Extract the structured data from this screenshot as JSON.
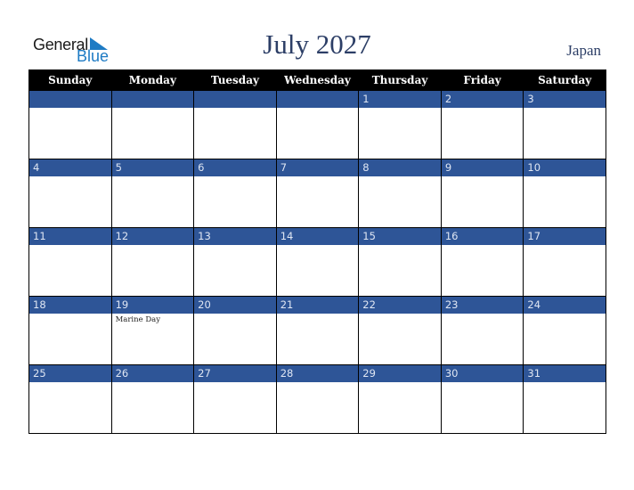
{
  "logo": {
    "word1": "General",
    "word2": "Blue",
    "icon": "triangle-flag-icon"
  },
  "header": {
    "title": "July 2027",
    "country": "Japan"
  },
  "colors": {
    "accent": "#2e5597",
    "header_bg": "#000000",
    "title": "#2c3e66",
    "logo_blue": "#1e7bc4"
  },
  "weekdays": [
    "Sunday",
    "Monday",
    "Tuesday",
    "Wednesday",
    "Thursday",
    "Friday",
    "Saturday"
  ],
  "weeks": [
    [
      {
        "day": ""
      },
      {
        "day": ""
      },
      {
        "day": ""
      },
      {
        "day": ""
      },
      {
        "day": "1"
      },
      {
        "day": "2"
      },
      {
        "day": "3"
      }
    ],
    [
      {
        "day": "4"
      },
      {
        "day": "5"
      },
      {
        "day": "6"
      },
      {
        "day": "7"
      },
      {
        "day": "8"
      },
      {
        "day": "9"
      },
      {
        "day": "10"
      }
    ],
    [
      {
        "day": "11"
      },
      {
        "day": "12"
      },
      {
        "day": "13"
      },
      {
        "day": "14"
      },
      {
        "day": "15"
      },
      {
        "day": "16"
      },
      {
        "day": "17"
      }
    ],
    [
      {
        "day": "18"
      },
      {
        "day": "19",
        "holiday": "Marine Day"
      },
      {
        "day": "20"
      },
      {
        "day": "21"
      },
      {
        "day": "22"
      },
      {
        "day": "23"
      },
      {
        "day": "24"
      }
    ],
    [
      {
        "day": "25"
      },
      {
        "day": "26"
      },
      {
        "day": "27"
      },
      {
        "day": "28"
      },
      {
        "day": "29"
      },
      {
        "day": "30"
      },
      {
        "day": "31"
      }
    ]
  ]
}
